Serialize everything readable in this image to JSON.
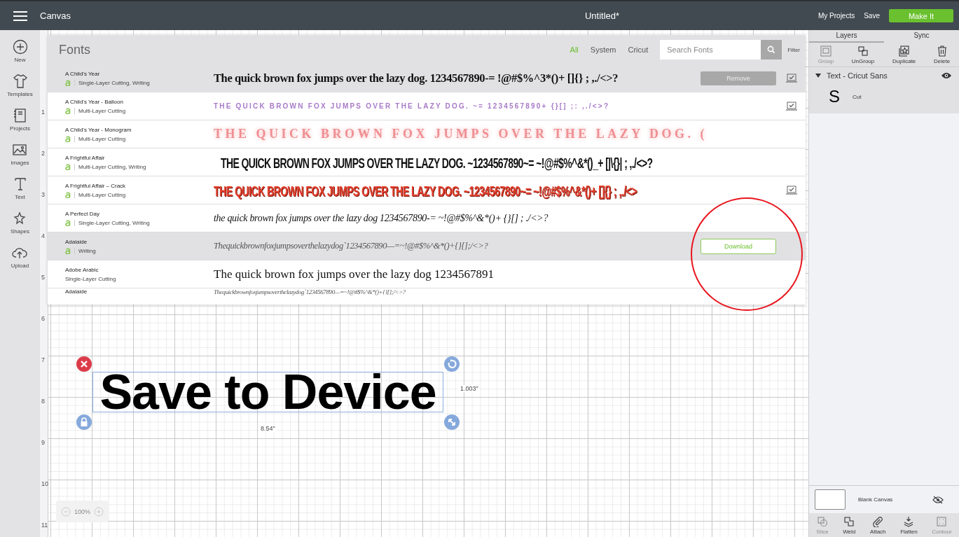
{
  "topbar": {
    "app_title": "Canvas",
    "document_title": "Untitled*",
    "links": [
      "My Projects",
      "Save"
    ],
    "make_it": "Make It"
  },
  "sidebar": {
    "items": [
      {
        "label": "New"
      },
      {
        "label": "Templates"
      },
      {
        "label": "Projects"
      },
      {
        "label": "Images"
      },
      {
        "label": "Text"
      },
      {
        "label": "Shapes"
      },
      {
        "label": "Upload"
      }
    ]
  },
  "ruler": {
    "numbers": [
      "1",
      "2",
      "3",
      "4",
      "5",
      "6",
      "7",
      "8",
      "9",
      "10",
      "11"
    ]
  },
  "fonts_dialog": {
    "title": "Fonts",
    "filters": [
      {
        "label": "All",
        "selected": true
      },
      {
        "label": "System",
        "selected": false
      },
      {
        "label": "Cricut",
        "selected": false
      }
    ],
    "search": {
      "placeholder": "Search Fonts"
    },
    "filter_label": "Filter",
    "rows": [
      {
        "name": "A Child's Year",
        "access": true,
        "categories": "Single-Layer Cutting, Writing",
        "kind": "playful",
        "sample": "The quick brown fox jumps over the lazy dog. 1234567890-= !@#$%^3*()+ []{} ; ,./<>?",
        "selected": true,
        "installed": true,
        "action": {
          "kind": "remove",
          "label": "Remove"
        }
      },
      {
        "name": "A Child's Year - Balloon",
        "access": true,
        "categories": "Multi-Layer Cutting",
        "kind": "balloon",
        "sample": "THE QUICK BROWN FOX JUMPS OVER THE LAZY DOG. ~= 1234567890+ {}[] ;: ,./<>?",
        "selected": false,
        "installed": true
      },
      {
        "name": "A Child's Year - Monogram",
        "access": true,
        "categories": "Multi-Layer Cutting",
        "kind": "monogram",
        "sample": "THE QUICK BROWN FOX JUMPS OVER THE LAZY DOG. (",
        "selected": false,
        "installed": false
      },
      {
        "name": "A Frightful Affair",
        "access": true,
        "categories": "Multi-Layer Cutting, Writing",
        "kind": "display",
        "sample": "THE QUICK BROWN FOX JUMPS OVER THE LAZY DOG. ~1234567890~= ~!@#$%^&*()_+ [|\\{}| ; ,./<>?",
        "selected": false,
        "installed": false
      },
      {
        "name": "A Frightful Affair – Crack",
        "access": true,
        "categories": "Multi-Layer Cutting",
        "kind": "crack",
        "sample": "THE QUICK BROWN FOX JUMPS OVER THE LAZY DOG. ~1234567890~= ~!@#$%^&*()+ []{} ; ,./<>",
        "selected": false,
        "installed": true
      },
      {
        "name": "A Perfect Day",
        "access": true,
        "categories": "Single-Layer Cutting, Writing",
        "kind": "handwriting",
        "sample": "the quick brown fox jumps over the lazy dog 1234567890-= ~!@#$%^&*()+ {}[] ; ./<>?",
        "selected": false,
        "installed": false
      },
      {
        "name": "Adalaide",
        "access": true,
        "categories": "Writing",
        "kind": "script",
        "sample": "Thequickbrownfoxjumpsoverthelazydog`1234567890—=~!@#$%^&*()+{}[];/<>?",
        "selected": true,
        "installed": false,
        "action": {
          "kind": "download",
          "label": "Download"
        }
      },
      {
        "name": "Adobe Arabic",
        "access": false,
        "categories": "Single-Layer Cutting",
        "kind": "serif",
        "sample": "The quick brown fox jumps over the lazy dog 1234567891",
        "selected": false,
        "installed": false
      },
      {
        "name": "Adalaide",
        "access": false,
        "kind": "script",
        "sample": "Thequickbrownfoxjumpsoverthelazydog`1234567890—=~!@#$%^&*()+{}[];/<>?",
        "selected": false,
        "installed": false
      }
    ]
  },
  "canvas_object": {
    "text": "Save to Device",
    "width": "8.54\"",
    "height": "1.003\""
  },
  "zoom": {
    "value": "100%"
  },
  "layers_panel": {
    "tabs": [
      {
        "label": "Layers",
        "selected": true
      },
      {
        "label": "Sync",
        "selected": false
      }
    ],
    "tools": [
      {
        "label": "Group",
        "disabled": true
      },
      {
        "label": "UnGroup",
        "disabled": false
      },
      {
        "label": "Duplicate",
        "disabled": false
      },
      {
        "label": "Delete",
        "disabled": false
      }
    ],
    "group": {
      "name": "Text - Cricut Sans",
      "expanded": true,
      "layers": [
        {
          "glyph": "S",
          "label": "Cut"
        }
      ]
    },
    "blank_canvas": {
      "label": "Blank Canvas",
      "hidden": true
    },
    "bottom_tools": [
      {
        "label": "Slice",
        "disabled": true
      },
      {
        "label": "Weld",
        "disabled": false
      },
      {
        "label": "Attach",
        "disabled": false
      },
      {
        "label": "Flatten",
        "disabled": false
      },
      {
        "label": "Contour",
        "disabled": true
      }
    ]
  },
  "annotation": {
    "kind": "circle"
  }
}
